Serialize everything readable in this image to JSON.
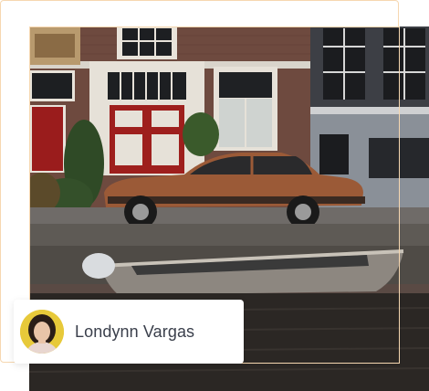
{
  "card": {
    "user_name": "Londynn Vargas"
  },
  "photo": {
    "subject": "photo-vintage-car-canal"
  },
  "colors": {
    "accent_outline": "#f6d7b0",
    "avatar_background": "#e7c93a",
    "name_text": "#3a3f4b"
  }
}
